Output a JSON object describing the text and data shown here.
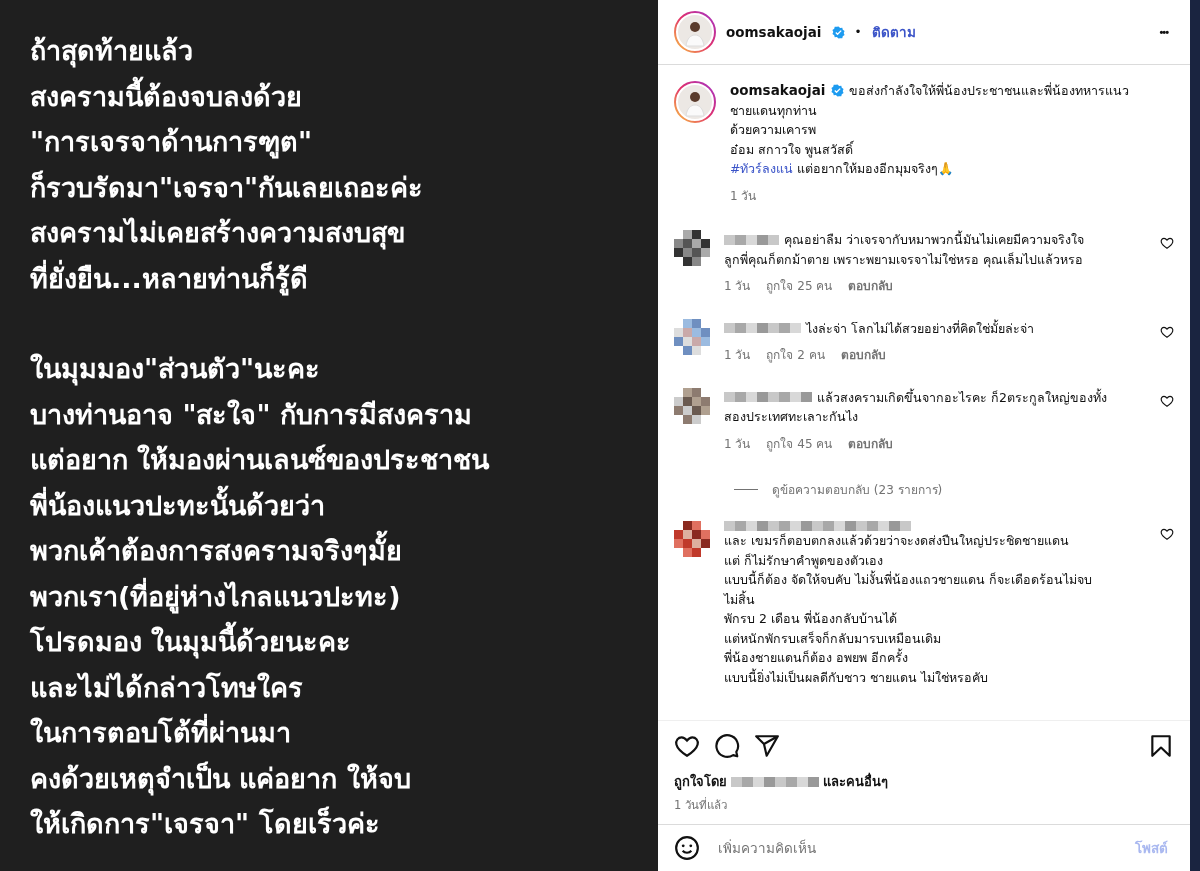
{
  "post_image": {
    "paragraphs": [
      [
        "ถ้าสุดท้ายแล้ว",
        "สงครามนี้ต้องจบลงด้วย",
        "\"การเจรจาด้านการฑูต\"",
        "ก็รวบรัดมา\"เจรจา\"กันเลยเถอะค่ะ",
        "สงครามไม่เคยสร้างความสงบสุข",
        "ที่ยั่งยืน...หลายท่านก็รู้ดี"
      ],
      [
        "ในมุมมอง\"ส่วนตัว\"นะคะ",
        "บางท่านอาจ \"สะใจ\" กับการมีสงคราม",
        "แต่อยาก ให้มองผ่านเลนซ์ของประชาชน",
        "พี่น้องแนวปะทะนั้นด้วยว่า",
        "พวกเค้าต้องการสงครามจริงๆมั้ย",
        "พวกเรา(ที่อยู่ห่างไกลแนวปะทะ)",
        "โปรดมอง ในมุมนี้ด้วยนะคะ",
        "และไม่ได้กล่าวโทษใคร",
        "ในการตอบโต้ที่ผ่านมา",
        "คงด้วยเหตุจำเป็น แค่อยาก ให้จบ",
        "ให้เกิดการ\"เจรจา\" โดยเร็วค่ะ"
      ]
    ]
  },
  "header": {
    "username": "oomsakaojai",
    "verified": true,
    "separator": "•",
    "follow": "ติดตาม",
    "more": "•••"
  },
  "caption": {
    "username": "oomsakaojai",
    "verified": true,
    "lines": [
      "ขอส่งกำลังใจให้พี่น้องประชาชนและพี่น้องทหารแนว",
      "ชายแดนทุกท่าน",
      "ด้วยความเคารพ",
      "อ๋อม สกาวใจ พูนสวัสดิ์"
    ],
    "hashtag": "#ทัวร์ลงแน่",
    "tail": " แต่อยากให้มองอีกมุมจริงๆ🙏",
    "time": "1 วัน"
  },
  "comments": [
    {
      "kind": "inline",
      "lines": [
        "คุณอย่าลืม ว่าเจรจากับหมาพวกนี้มันไม่เคยมีความจริงใจ",
        "ลูกพี่คุณก็ตกม้าตาย เพราะพยามเจรจาไม่ใช่หรอ คุณเล็มไปแล้วหรอ"
      ],
      "time": "1 วัน",
      "likes": "ถูกใจ 25 คน",
      "reply": "ตอบกลับ"
    },
    {
      "kind": "inline",
      "lines": [
        "ไงล่ะจ่า โลกไม่ได้สวยอย่างที่คิดใช่มั้ยล่ะจ่า"
      ],
      "time": "1 วัน",
      "likes": "ถูกใจ 2 คน",
      "reply": "ตอบกลับ"
    },
    {
      "kind": "inline",
      "lines": [
        "แล้วสงครามเกิดขึ้นจากอะไรคะ ก็2ตระกูลใหญ่ของทั้ง",
        "สองประเทศทะเลาะกันไง"
      ],
      "time": "1 วัน",
      "likes": "ถูกใจ 45 คน",
      "reply": "ตอบกลับ",
      "view_replies": "ดูข้อความตอบกลับ (23 รายการ)"
    },
    {
      "kind": "stacked",
      "lines": [
        "และ เขมรก็ตอบตกลงแล้วด้วยว่าจะงดส่งปืนใหญ่ประชิดชายแดน",
        "แต่ ก็ไม่รักษาคำพูดของตัวเอง",
        "แบบนี้ก็ต้อง จัดให้จบคับ ไม่งั้นพี่น้องแถวชายแดน ก็จะเดือดร้อนไม่จบ",
        "ไม่สิ้น",
        "พักรบ 2 เดือน พี่น้องกลับบ้านได้",
        "แต่หนักพักรบเสร็จก็กลับมารบเหมือนเดิม",
        "พี่น้องชายแดนก็ต้อง อพยพ อีกครั้ง",
        "แบบนี้ยิ่งไม่เป็นผลดีกับชาว ชายแดน ไม่ใช่หรอคับ"
      ]
    }
  ],
  "actions": {
    "liked": false,
    "saved": false
  },
  "likes": {
    "prefix": "ถูกใจโดย",
    "suffix": "และคนอื่นๆ"
  },
  "posted": "1 วันที่แล้ว",
  "composer": {
    "placeholder": "เพิ่มความคิดเห็น",
    "post": "โพสต์"
  }
}
